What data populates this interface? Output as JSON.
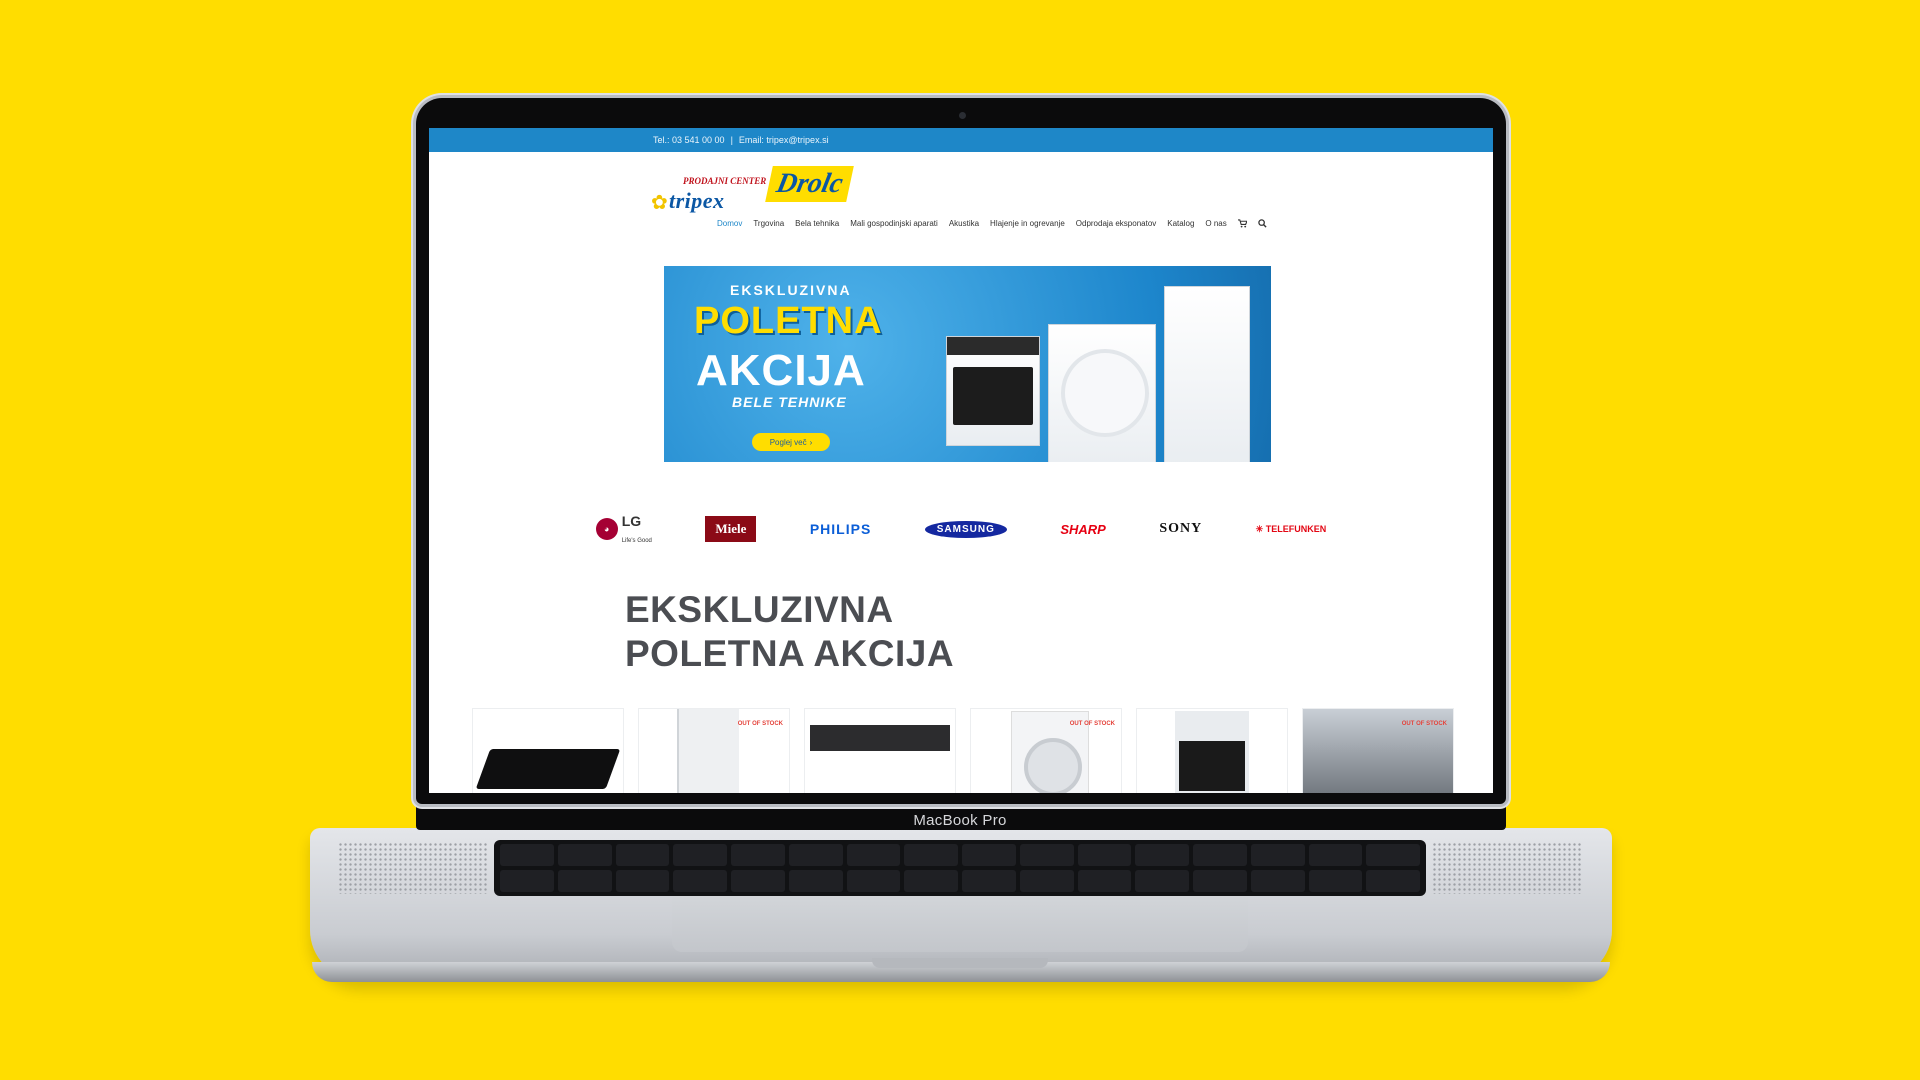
{
  "laptop": {
    "model_label": "MacBook Pro"
  },
  "site": {
    "topbar": {
      "phone": "Tel.: 03 541 00 00",
      "separator": "|",
      "email": "Email: tripex@tripex.si"
    },
    "logo": {
      "line1": "PRODAJNI CENTER",
      "brand": "tripex",
      "name": "Drolc"
    },
    "nav": {
      "items": [
        "Domov",
        "Trgovina",
        "Bela tehnika",
        "Mali gospodinjski aparati",
        "Akustika",
        "Hlajenje in ogrevanje",
        "Odprodaja eksponatov",
        "Katalog",
        "O nas"
      ],
      "active": "Domov",
      "cart_icon": "cart-icon",
      "search_icon": "search-icon"
    },
    "banner": {
      "line1": "EKSKLUZIVNA",
      "line2": "POLETNA",
      "line3": "AKCIJA",
      "line4": "BELE TEHNIKE",
      "button": "Poglej več",
      "button_icon": "chevron-right-icon"
    },
    "brands": {
      "lg": "LG",
      "lg_tagline": "Life's Good",
      "miele": "Miele",
      "philips": "PHILIPS",
      "samsung": "SAMSUNG",
      "sharp": "SHARP",
      "sony": "SONY",
      "telefunken": "TELEFUNKEN"
    },
    "section": {
      "title_line1": "EKSKLUZIVNA",
      "title_line2": "POLETNA AKCIJA"
    },
    "products": [
      {
        "badge": ""
      },
      {
        "badge": "OUT OF STOCK"
      },
      {
        "badge": ""
      },
      {
        "badge": "OUT OF STOCK"
      },
      {
        "badge": ""
      },
      {
        "badge": "OUT OF STOCK"
      }
    ]
  },
  "colors": {
    "background": "#FFDD00",
    "topbar": "#1e87c8",
    "banner": "#1d86cc",
    "accent_yellow": "#ffdd00"
  }
}
